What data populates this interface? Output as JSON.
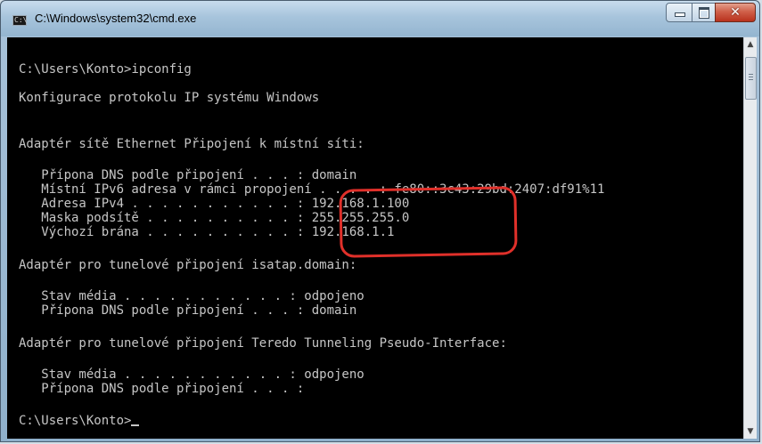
{
  "window": {
    "title": "C:\\Windows\\system32\\cmd.exe",
    "icon": "cmd-icon",
    "controls": {
      "minimize": "minimize-icon",
      "maximize": "maximize-icon",
      "close": "close-icon"
    }
  },
  "console": {
    "prompt_command": "C:\\Users\\Konto>ipconfig",
    "heading": "Konfigurace protokolu IP systému Windows",
    "adapter1": {
      "title": "Adaptér sítě Ethernet Připojení k místní síti:",
      "dns_suffix": "   Přípona DNS podle připojení . . . : domain",
      "ipv6": "   Místní IPv6 adresa v rámci propojení . . . . : fe80::3c43:29bd:2407:df91%11",
      "ipv4": "   Adresa IPv4 . . . . . . . . . . . : 192.168.1.100",
      "mask": "   Maska podsítě . . . . . . . . . . : 255.255.255.0",
      "gateway": "   Výchozí brána . . . . . . . . . . : 192.168.1.1"
    },
    "adapter2": {
      "title": "Adaptér pro tunelové připojení isatap.domain:",
      "media": "   Stav média . . . . . . . . . . . : odpojeno",
      "dns_suffix": "   Přípona DNS podle připojení . . . : domain"
    },
    "adapter3": {
      "title": "Adaptér pro tunelové připojení Teredo Tunneling Pseudo-Interface:",
      "media": "   Stav média . . . . . . . . . . . : odpojeno",
      "dns_suffix": "   Přípona DNS podle připojení . . . :"
    },
    "prompt": "C:\\Users\\Konto>"
  },
  "annotation": {
    "color": "#e0302a"
  },
  "colors": {
    "console_bg": "#000000",
    "console_fg": "#c6c6c6"
  }
}
